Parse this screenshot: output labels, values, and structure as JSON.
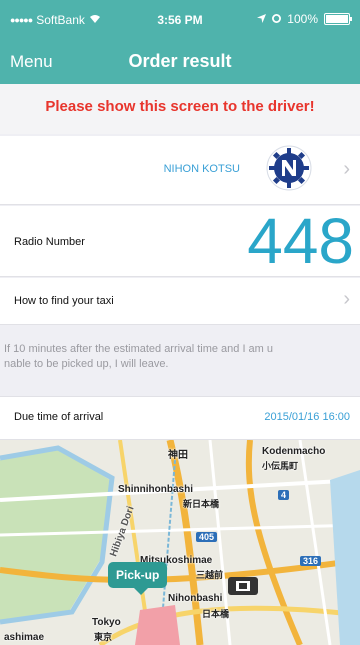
{
  "status_bar": {
    "carrier": "SoftBank",
    "time": "3:56 PM",
    "battery": "100%"
  },
  "navbar": {
    "menu_label": "Menu",
    "title": "Order result"
  },
  "warning_text": "Please show this screen to the driver!",
  "company": {
    "name": "NIHON KOTSU"
  },
  "radio": {
    "label": "Radio Number",
    "number": "448"
  },
  "how_to_find": {
    "label": "How to find your taxi"
  },
  "note": {
    "line1": "If 10 minutes after the estimated arrival time and I am u",
    "line2": "nable to be picked up, I will leave."
  },
  "due": {
    "label": "Due time of arrival",
    "value": "2015/01/16 16:00"
  },
  "map": {
    "pickup_label": "Pick-up",
    "labels": {
      "kanda": "神田",
      "kodenmacho": "Kodenmacho",
      "kodenmacho_jp": "小伝馬町",
      "shinnihonbashi": "Shinnihonbashi",
      "shinnihonbashi_jp": "新日本橋",
      "hibiya_dori": "Hibiya Dori",
      "mitsukoshimae": "Mitsukoshimae",
      "mitsukoshimae_jp": "三越前",
      "nihonbashi": "Nihonbashi",
      "nihonbashi_jp": "日本橋",
      "tokyo": "Tokyo",
      "tokyo_jp": "東京",
      "ashimae": "ashimae",
      "route_405": "405",
      "route_316": "316",
      "route_4": "4"
    }
  }
}
